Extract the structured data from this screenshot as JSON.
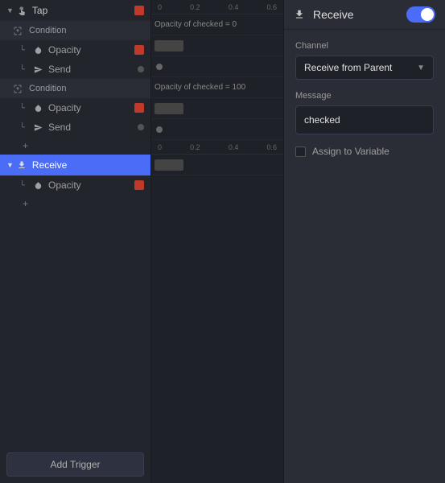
{
  "leftPanel": {
    "triggers": [
      {
        "type": "top-level",
        "label": "Tap",
        "icon": "tap",
        "hasColorBox": true,
        "collapsed": false
      }
    ],
    "conditions": [
      {
        "label": "Condition",
        "subItems": [
          {
            "label": "Opacity",
            "hasColorBox": true,
            "hasDot": false
          },
          {
            "label": "Send",
            "hasColorBox": false,
            "hasDot": true
          }
        ]
      },
      {
        "label": "Condition",
        "subItems": [
          {
            "label": "Opacity",
            "hasColorBox": true,
            "hasDot": false
          },
          {
            "label": "Send",
            "hasColorBox": false,
            "hasDot": true
          }
        ]
      }
    ],
    "receiveItem": {
      "label": "Receive",
      "selected": true,
      "subItems": [
        {
          "label": "Opacity",
          "hasColorBox": true
        }
      ],
      "plusLabel": "+"
    },
    "addTriggerLabel": "Add Trigger",
    "plusLabel": "+"
  },
  "middlePanel": {
    "ruler": [
      "0",
      "0.2",
      "0.4",
      "0.6"
    ],
    "condition1Label": "Opacity of checked = 0",
    "condition2Label": "Opacity of checked = 100",
    "rows": 8
  },
  "rightPanel": {
    "title": "Receive",
    "channelLabel": "Channel",
    "channelValue": "Receive from Parent",
    "messageLabel": "Message",
    "messageValue": "checked",
    "assignLabel": "Assign to Variable",
    "toggleEnabled": true
  }
}
